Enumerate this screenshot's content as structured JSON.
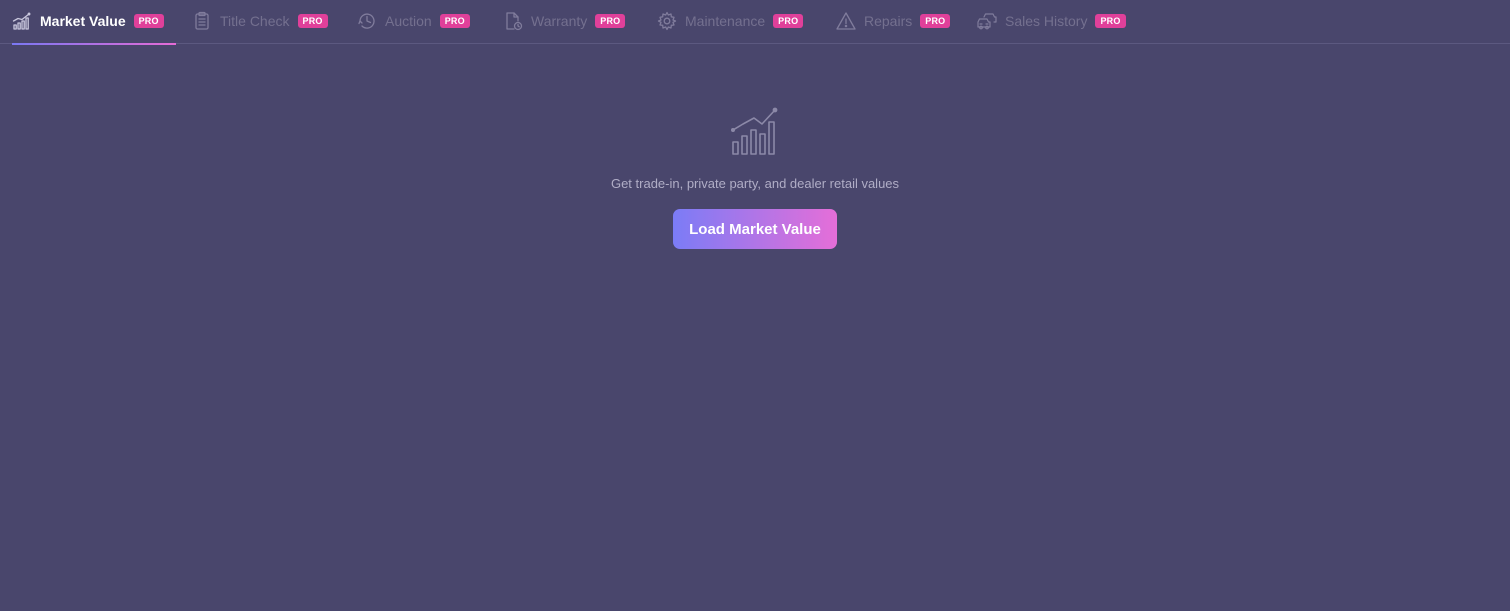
{
  "tabs": [
    {
      "label": "Market Value",
      "badge": "PRO",
      "icon": "bar-chart-icon",
      "active": true
    },
    {
      "label": "Title Check",
      "badge": "PRO",
      "icon": "clipboard-icon",
      "active": false
    },
    {
      "label": "Auction",
      "badge": "PRO",
      "icon": "clock-icon",
      "active": false
    },
    {
      "label": "Warranty",
      "badge": "PRO",
      "icon": "document-clock-icon",
      "active": false
    },
    {
      "label": "Maintenance",
      "badge": "PRO",
      "icon": "gear-icon",
      "active": false
    },
    {
      "label": "Repairs",
      "badge": "PRO",
      "icon": "warning-icon",
      "active": false
    },
    {
      "label": "Sales History",
      "badge": "PRO",
      "icon": "cars-icon",
      "active": false
    }
  ],
  "empty_state": {
    "icon": "bar-chart-icon",
    "description": "Get trade-in, private party, and dealer retail values",
    "button_label": "Load Market Value"
  },
  "colors": {
    "background": "#49466c",
    "badge": "#e0409a",
    "accent_start": "#7b7cf6",
    "accent_end": "#e56ed8",
    "inactive_text": "#74708f"
  }
}
